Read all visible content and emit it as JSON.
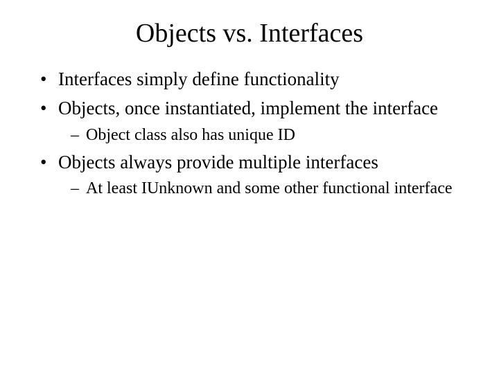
{
  "title": "Objects vs. Interfaces",
  "bullets": {
    "b1": "Interfaces simply define functionality",
    "b2": "Objects, once instantiated, implement the interface",
    "b2_sub1": "Object class also has unique ID",
    "b3": "Objects always provide multiple interfaces",
    "b3_sub1": "At least IUnknown and some other functional interface"
  }
}
